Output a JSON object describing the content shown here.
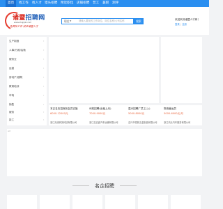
{
  "nav": [
    "首页",
    "找工作",
    "找人才",
    "猎头招聘",
    "附近职位",
    "店铺招聘",
    "普工",
    "兼职",
    "测评"
  ],
  "logo": {
    "main": "诸暨",
    "accent": "招聘网",
    "sub": "www.zhujijob.com",
    "tagline": "免费找工作 就来诸暨人才"
  },
  "search": {
    "category": "职位",
    "placeholder": "请输入要找的工作岗位，岗位名称/公司名称",
    "button": "搜索"
  },
  "welcome": {
    "text": "欢迎来到诸暨人才网！",
    "login": "登录",
    "register": "注册"
  },
  "categories": [
    "生产制造",
    "人事/行政/后勤",
    "服务业",
    "运营",
    "房地产/建筑",
    "教育培训",
    "市场",
    "销售",
    "服务",
    "技工"
  ],
  "cards": [
    {
      "title": "本正名在招商务会员实施",
      "salary": "6000-12000元",
      "company": "浙江天绿商务科技有限公司"
    },
    {
      "title": "司机招聘(出租上月)",
      "salary": "7000-9000元",
      "company": "浙江嘉嘉鑫汽车运输有限公司"
    },
    {
      "title": "嘉兴招聘厂员工(入)",
      "salary": "5000-8000元",
      "company": "嘉兴市恒新五金制品有限公司"
    },
    {
      "title": "物流营运员",
      "salary": "5000-6000元/月",
      "company": "浙江鸿元汽车服务有限公司"
    }
  ],
  "ad_alt": "ad",
  "section_title": "名企招聘"
}
